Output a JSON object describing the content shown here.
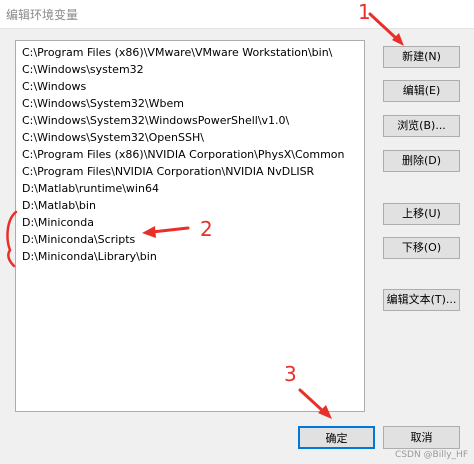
{
  "window": {
    "title": "编辑环境变量"
  },
  "path_list": {
    "items": [
      "C:\\Program Files (x86)\\VMware\\VMware Workstation\\bin\\",
      "C:\\Windows\\system32",
      "C:\\Windows",
      "C:\\Windows\\System32\\Wbem",
      "C:\\Windows\\System32\\WindowsPowerShell\\v1.0\\",
      "C:\\Windows\\System32\\OpenSSH\\",
      "C:\\Program Files (x86)\\NVIDIA Corporation\\PhysX\\Common",
      "C:\\Program Files\\NVIDIA Corporation\\NVIDIA NvDLISR",
      "D:\\Matlab\\runtime\\win64",
      "D:\\Matlab\\bin",
      "D:\\Miniconda",
      "D:\\Miniconda\\Scripts",
      "D:\\Miniconda\\Library\\bin"
    ]
  },
  "buttons": {
    "new": "新建(N)",
    "edit": "编辑(E)",
    "browse": "浏览(B)...",
    "delete": "删除(D)",
    "move_up": "上移(U)",
    "move_down": "下移(O)",
    "edit_text": "编辑文本(T)...",
    "ok": "确定",
    "cancel": "取消"
  },
  "annotations": {
    "label_1": "1",
    "label_2": "2",
    "label_3": "3",
    "color": "#e8302b"
  },
  "watermark": "CSDN @Billy_HF"
}
